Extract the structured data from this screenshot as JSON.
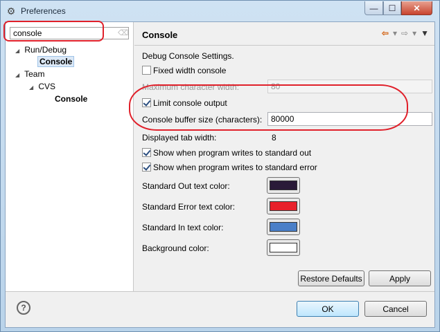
{
  "window": {
    "title": "Preferences",
    "minimize_glyph": "—",
    "maximize_glyph": "☐",
    "close_glyph": "✕"
  },
  "filter": {
    "value": "console"
  },
  "tree": {
    "run_debug": "Run/Debug",
    "run_debug_console": "Console",
    "team": "Team",
    "cvs": "CVS",
    "cvs_console": "Console"
  },
  "page": {
    "title": "Console",
    "section_label": "Debug Console Settings.",
    "fixed_width": "Fixed width console",
    "max_char_width_label": "Maximum character width:",
    "max_char_width_value": "80",
    "limit_output": "Limit console output",
    "buffer_size_label": "Console buffer size (characters):",
    "buffer_size_value": "80000",
    "tab_width_label": "Displayed tab width:",
    "tab_width_value": "8",
    "show_stdout": "Show when program writes to standard out",
    "show_stderr": "Show when program writes to standard error",
    "std_out_color_label": "Standard Out text color:",
    "std_err_color_label": "Standard Error text color:",
    "std_in_color_label": "Standard In text color:",
    "background_color_label": "Background color:"
  },
  "colors": {
    "std_out": "#2a1a38",
    "std_err": "#e8202a",
    "std_in": "#4a7fc8",
    "background": "#ffffff"
  },
  "buttons": {
    "restore_defaults": "Restore Defaults",
    "apply": "Apply",
    "ok": "OK",
    "cancel": "Cancel"
  }
}
